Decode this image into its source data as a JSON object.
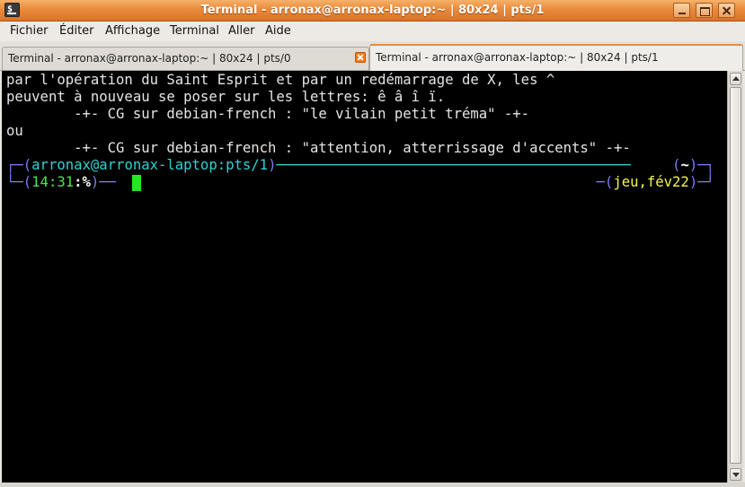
{
  "window": {
    "title": "Terminal - arronax@arronax-laptop:~ | 80x24 | pts/1",
    "app_icon_glyph": "$",
    "icons": {
      "app": "terminal-icon",
      "minimize": "minimize-icon",
      "maximize": "maximize-icon",
      "close": "close-icon"
    }
  },
  "menu": {
    "items": [
      {
        "label": "Fichier"
      },
      {
        "label": "Éditer"
      },
      {
        "label": "Affichage"
      },
      {
        "label": "Terminal"
      },
      {
        "label": "Aller"
      },
      {
        "label": "Aide"
      }
    ]
  },
  "tabs": [
    {
      "label": "Terminal - arronax@arronax-laptop:~ | 80x24 | pts/0",
      "active": false
    },
    {
      "label": "Terminal - arronax@arronax-laptop:~ | 80x24 | pts/1",
      "active": true
    }
  ],
  "terminal": {
    "lines": [
      "par l'opération du Saint Esprit et par un redémarrage de X, les ^",
      "peuvent à nouveau se poser sur les lettres: ê â î ï.",
      "        -+- CG sur debian-french : \"le vilain petit tréma\" -+-",
      "ou",
      "        -+- CG sur debian-french : \"attention, atterrissage d'accents\" -+-"
    ],
    "prompt": {
      "line1_left_open": "┌─(",
      "user_host": "arronax@arronax-laptop",
      "colon": ":",
      "tty": "pts/1",
      "line1_left_close": ")",
      "line1_fill": "──────────────────────────────────────────",
      "line1_right_open": "(",
      "cwd": "~",
      "line1_right_close": ")─┐",
      "line2_left_open": "└─(",
      "time": "14:31",
      "sep": ":",
      "symbol": "%",
      "line2_left_close": ")──",
      "line2_right_open": "─(",
      "date": "jeu,fév22",
      "line2_right_close": ")─┘"
    },
    "colors": {
      "background": "#000000",
      "text": "#e5e5e5",
      "frame": "#7b7bf2",
      "user_host": "#2cd4d4",
      "time": "#4fe34f",
      "date": "#f5f54a",
      "cursor": "#22e822"
    }
  }
}
